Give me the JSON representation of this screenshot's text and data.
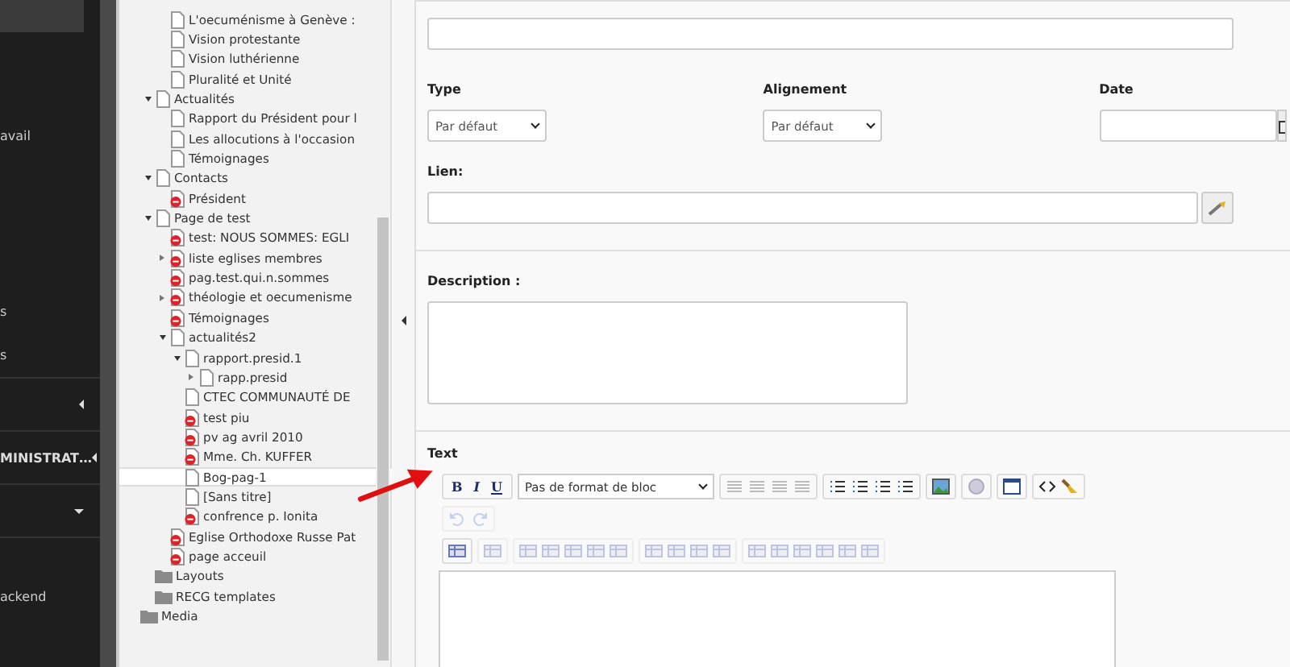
{
  "sidebar": {
    "items": [
      {
        "label": "avail"
      },
      {
        "label": "s"
      },
      {
        "label": "s"
      },
      {
        "expanded": false
      },
      {
        "label": "MINISTRAT…",
        "expanded": false
      },
      {
        "expanded": true
      },
      {
        "label": "ackend"
      }
    ]
  },
  "tree": {
    "continued_items": [
      {
        "label": "L'oecuménisme à  Genève :",
        "kind": "page",
        "selected": false
      },
      {
        "label": "Vision protestante",
        "kind": "page",
        "selected": false
      },
      {
        "label": "Vision luthérienne",
        "kind": "page",
        "selected": false
      },
      {
        "label": "Pluralité et Unité",
        "kind": "page",
        "selected": false
      }
    ],
    "items": [
      {
        "label": "Actualités",
        "kind": "page",
        "selected": false,
        "expanded": true,
        "children": [
          {
            "label": "Rapport du Président pour l",
            "kind": "page",
            "selected": false
          },
          {
            "label": "Les allocutions à  l'occasion",
            "kind": "page",
            "selected": false
          },
          {
            "label": "Témoignages",
            "kind": "page",
            "selected": false
          }
        ]
      },
      {
        "label": "Contacts",
        "kind": "page",
        "selected": false,
        "expanded": true,
        "children": [
          {
            "label": "Président",
            "kind": "hidden",
            "selected": false
          }
        ]
      },
      {
        "label": "Page de test",
        "kind": "page",
        "selected": false,
        "expanded": true,
        "children": [
          {
            "label": "test: NOUS SOMMES: EGLI",
            "kind": "hidden",
            "selected": false
          },
          {
            "label": "liste eglises membres",
            "kind": "hidden",
            "selected": false,
            "expanded": false
          },
          {
            "label": "pag.test.qui.n.sommes",
            "kind": "hidden",
            "selected": false
          },
          {
            "label": "théologie et oecumenisme",
            "kind": "hidden",
            "selected": false,
            "expanded": false
          },
          {
            "label": "Témoignages",
            "kind": "hidden",
            "selected": false
          },
          {
            "label": "actualités2",
            "kind": "page",
            "selected": false,
            "expanded": true,
            "children": [
              {
                "label": "rapport.presid.1",
                "kind": "page",
                "selected": false,
                "expanded": true,
                "children": [
                  {
                    "label": "rapp.presid",
                    "kind": "page",
                    "selected": false,
                    "expanded": false
                  }
                ]
              },
              {
                "label": "CTEC COMMUNAUTÉ DE",
                "kind": "page",
                "selected": false
              },
              {
                "label": "test piu",
                "kind": "hidden",
                "selected": false
              },
              {
                "label": "pv ag avril 2010",
                "kind": "hidden",
                "selected": false
              },
              {
                "label": "Mme. Ch. KUFFER",
                "kind": "hidden",
                "selected": false
              },
              {
                "label": "Bog-pag-1",
                "kind": "page",
                "selected": true
              },
              {
                "label": "[Sans titre]",
                "kind": "page",
                "selected": false
              },
              {
                "label": "confrence p. Ionita",
                "kind": "hidden",
                "selected": false
              }
            ]
          },
          {
            "label": "Eglise Orthodoxe Russe Pat",
            "kind": "hidden",
            "selected": false
          },
          {
            "label": "page acceuil",
            "kind": "hidden",
            "selected": false
          }
        ]
      },
      {
        "label": "Layouts",
        "kind": "folder",
        "selected": false
      },
      {
        "label": "RECG templates",
        "kind": "folder",
        "selected": false
      }
    ],
    "root_items": [
      {
        "label": "Media",
        "kind": "folder",
        "selected": false
      }
    ]
  },
  "form": {
    "type": {
      "label": "Type",
      "value": "Par défaut"
    },
    "alignment": {
      "label": "Alignement",
      "value": "Par défaut"
    },
    "date": {
      "label": "Date"
    },
    "link": {
      "label": "Lien:"
    },
    "description": {
      "label": "Description :"
    },
    "text": {
      "label": "Text",
      "format_buttons": [
        "B",
        "I",
        "U"
      ],
      "block_format": "Pas de format de bloc",
      "history_disabled": true,
      "table_tools_disabled": true
    }
  }
}
